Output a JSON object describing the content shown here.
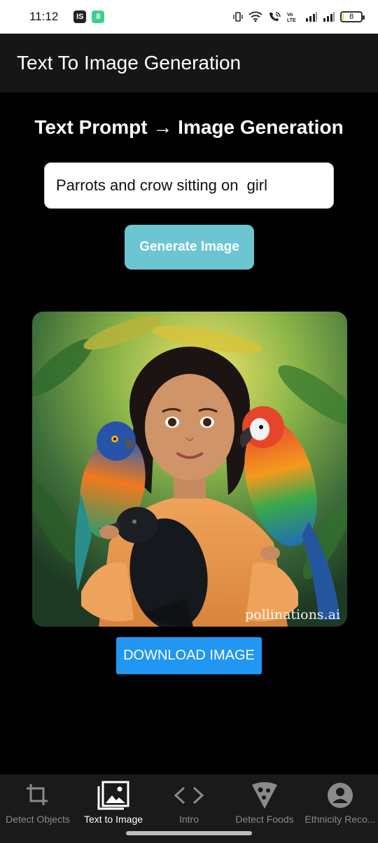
{
  "status_bar": {
    "time": "11:12",
    "chip_1": "IS",
    "chip_2": "8",
    "battery": "8"
  },
  "app_bar": {
    "title": "Text To Image Generation"
  },
  "main": {
    "section_title": "Text Prompt → Image  Generation",
    "prompt_value": "Parrots and crow sitting on  girl",
    "generate_label": "Generate Image",
    "image": {
      "description_icon": "generated-image",
      "watermark": "pollinations.ai"
    },
    "download_label": "DOWNLOAD IMAGE"
  },
  "bottom_nav": {
    "items": [
      {
        "label": "Detect Objects",
        "icon": "crop-icon",
        "active": false
      },
      {
        "label": "Text to Image",
        "icon": "image-icon",
        "active": true
      },
      {
        "label": "Intro",
        "icon": "code-icon",
        "active": false
      },
      {
        "label": "Detect Foods",
        "icon": "pizza-icon",
        "active": false
      },
      {
        "label": "Ethnicity Reco...",
        "icon": "account-icon",
        "active": false
      }
    ]
  },
  "colors": {
    "accent_teal": "#6cc6d1",
    "download_blue": "#2196f3",
    "app_bar": "#161616",
    "nav_bg": "#1a1a1a"
  }
}
